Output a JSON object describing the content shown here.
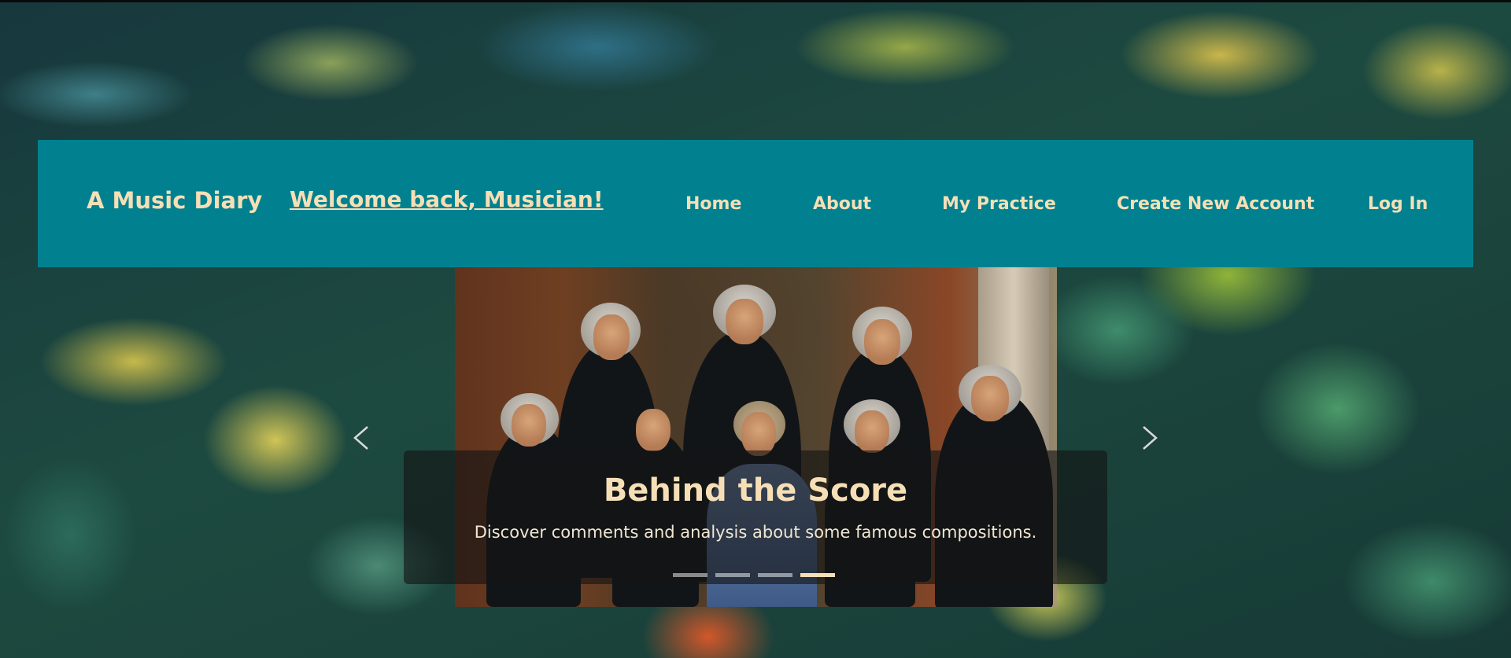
{
  "navbar": {
    "brand": "A Music Diary",
    "welcome": "Welcome back, Musician!",
    "links": [
      "Home",
      "About",
      "My Practice",
      "Create New Account",
      "Log In"
    ]
  },
  "carousel": {
    "title": "Behind the Score",
    "subtitle": "Discover comments and analysis about some famous compositions.",
    "slide_count": 4,
    "active_slide": 4,
    "prev_icon": "chevron-left-icon",
    "next_icon": "chevron-right-icon"
  },
  "colors": {
    "navbar_bg": "#01818f",
    "nav_text": "#f6dfb6"
  }
}
